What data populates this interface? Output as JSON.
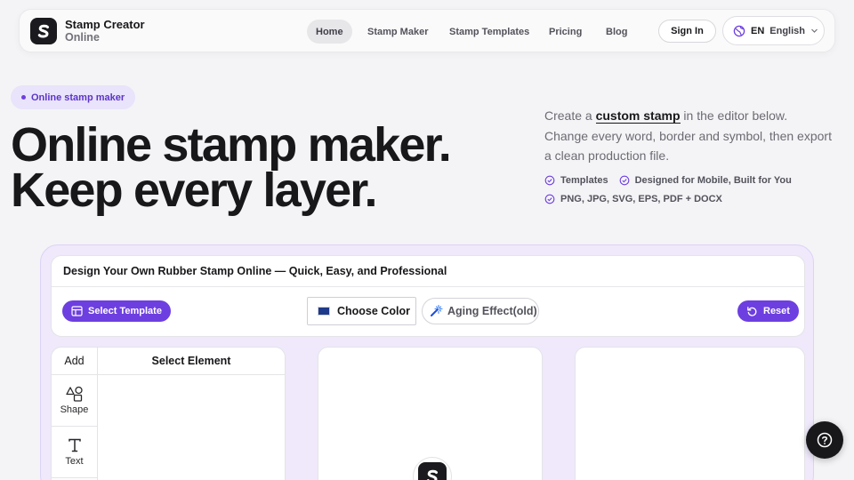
{
  "header": {
    "brand_name": "Stamp Creator",
    "brand_sub": "Online",
    "nav": [
      {
        "label": "Home",
        "active": true
      },
      {
        "label": "Stamp Maker",
        "active": false
      },
      {
        "label": "Stamp Templates",
        "active": false
      },
      {
        "label": "Pricing",
        "active": false
      },
      {
        "label": "Blog",
        "active": false
      }
    ],
    "sign_in": "Sign In",
    "lang_code": "EN",
    "lang_name": "English",
    "lang_icon": "globe-icon"
  },
  "hero": {
    "pill": "Online stamp maker",
    "title_line1": "Online stamp maker.",
    "title_line2": "Keep every layer.",
    "desc_before": "Create a ",
    "desc_link": "custom stamp",
    "desc_after": " in the editor below. Change every word, border and symbol, then export a clean production file.",
    "checks": [
      "Templates",
      "Designed for Mobile, Built for You",
      "PNG, JPG, SVG, EPS, PDF + DOCX"
    ]
  },
  "editor": {
    "title": "Design Your Own Rubber Stamp Online — Quick, Easy, and Professional",
    "select_template": "Select Template",
    "choose_color": "Choose Color",
    "aging": "Aging Effect(old)",
    "reset": "Reset",
    "add_label": "Add",
    "select_element": "Select Element",
    "tools": [
      {
        "label": "Shape",
        "icon": "shapes-icon"
      },
      {
        "label": "Text",
        "icon": "text-icon"
      }
    ]
  },
  "colors": {
    "accent": "#6d3fe0",
    "swatch": "#1e3a8a",
    "dark": "#18181b"
  }
}
